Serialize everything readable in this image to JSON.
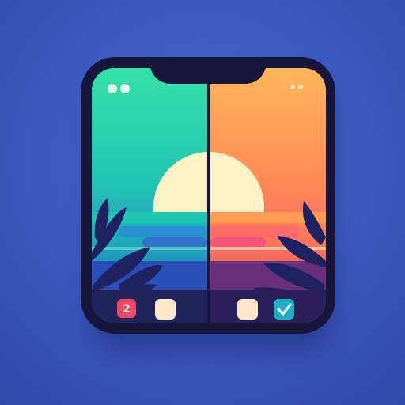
{
  "app_icon": {
    "left_panel": {
      "sky_gradient": [
        "#36e0a8",
        "#1fb4b0",
        "#2e6fcf"
      ],
      "badge_label": "2",
      "badge_color": "#f04a6a",
      "square_color": "#fde7c9",
      "state": "before"
    },
    "right_panel": {
      "sky_gradient": [
        "#ffb05a",
        "#ff7a55",
        "#f4487a"
      ],
      "check_icon": "check-icon",
      "check_color": "#1fb0c8",
      "square_color": "#fde7c9",
      "state": "after"
    },
    "sun_color": "#fdf1c6",
    "frame_color": "#16163a",
    "background_color": "#3f5fc7"
  }
}
